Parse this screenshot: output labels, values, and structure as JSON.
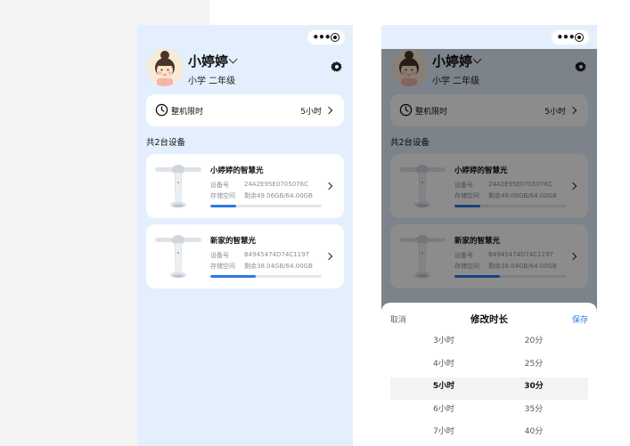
{
  "user": {
    "name": "小婷婷",
    "grade": "小学 二年级"
  },
  "limit": {
    "label": "整机限时",
    "value": "5小时"
  },
  "device_count": "共2台设备",
  "devices": [
    {
      "name": "小婷婷的智慧光",
      "id_label": "设备号",
      "id": "24A2E95E0705076C",
      "storage_label": "存储空间",
      "storage": "剩余49.06GB/64.00GB",
      "used_fraction": 0.233
    },
    {
      "name": "新家的智慧光",
      "id_label": "设备号",
      "id": "B4945474D74C1197",
      "storage_label": "存储空间",
      "storage": "剩余38.04GB/64.00GB",
      "used_fraction": 0.406
    }
  ],
  "sheet": {
    "cancel": "取消",
    "title": "修改时长",
    "save": "保存",
    "hours": [
      "3小时",
      "4小时",
      "5小时",
      "6小时",
      "7小时"
    ],
    "minutes": [
      "20分",
      "25分",
      "30分",
      "35分",
      "40分"
    ],
    "selected_index": 2
  },
  "colors": {
    "accent": "#2a7be4",
    "page_bg": "#e3effc"
  }
}
